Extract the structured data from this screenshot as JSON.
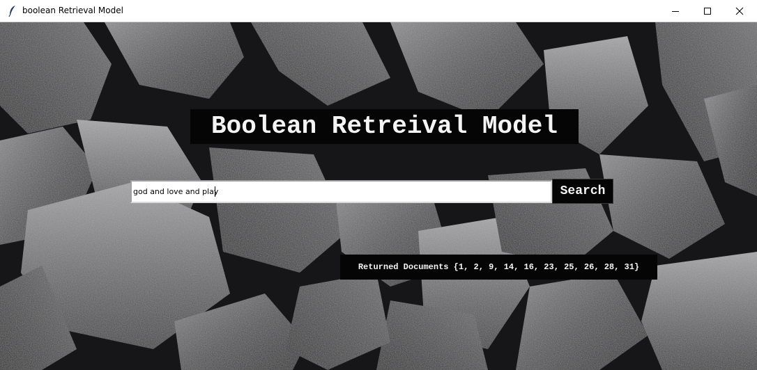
{
  "window": {
    "title": "boolean Retrieval Model",
    "icon": "feather-icon",
    "controls": [
      "minimize-icon",
      "maximize-icon",
      "close-icon"
    ]
  },
  "main": {
    "heading": "Boolean Retreival Model",
    "search": {
      "value": "god and love and play",
      "button_label": "Search"
    },
    "result": "Returned Documents {1, 2, 9, 14, 16, 23, 25, 26, 28, 31}"
  },
  "colors": {
    "background": "#17171a",
    "label_background": "#050505",
    "label_text": "#f4f4f4",
    "titlebar": "#ffffff"
  }
}
